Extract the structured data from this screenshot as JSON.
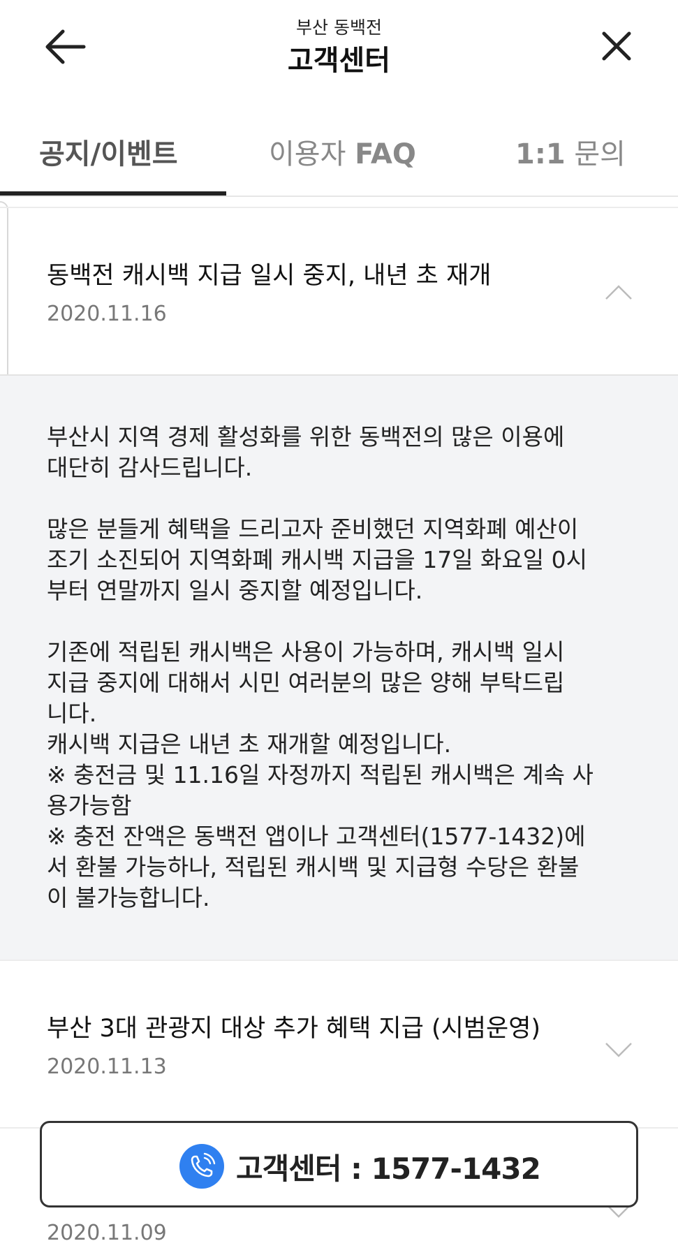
{
  "header": {
    "subtitle": "부산 동백전",
    "title": "고객센터"
  },
  "tabs": [
    {
      "label": "공지/이벤트",
      "active": true
    },
    {
      "label_prefix": "이용자 ",
      "label_bold": "FAQ",
      "active": false
    },
    {
      "label_bold": "1:1",
      "label_suffix": " 문의",
      "active": false
    }
  ],
  "notices": [
    {
      "title": "동백전 캐시백 지급 일시 중지, 내년 초 재개",
      "date": "2020.11.16",
      "expanded": true,
      "body": "부산시 지역 경제 활성화를 위한 동백전의 많은 이용에\n대단히 감사드립니다.\n\n많은 분들게 혜택을 드리고자 준비했던 지역화폐 예산이\n조기 소진되어 지역화폐 캐시백 지급을 17일 화요일 0시\n부터 연말까지 일시 중지할 예정입니다.\n\n기존에 적립된 캐시백은 사용이 가능하며, 캐시백 일시\n지급 중지에 대해서 시민 여러분의 많은 양해 부탁드립\n니다.\n캐시백 지급은 내년 초 재개할 예정입니다.\n※ 충전금 및 11.16일 자정까지 적립된 캐시백은 계속 사\n용가능함\n※ 충전 잔액은 동백전 앱이나 고객센터(1577-1432)에\n서 환불 가능하나, 적립된 캐시백 및 지급형 수당은 환불\n이 불가능합니다."
    },
    {
      "title": "부산 3대 관광지 대상 추가 혜택 지급 (시범운영)",
      "date": "2020.11.13",
      "expanded": false
    },
    {
      "title": "",
      "date": "2020.11.09",
      "expanded": false
    }
  ],
  "call_button": {
    "label": "고객센터 : 1577-1432"
  },
  "colors": {
    "accent": "#2f80f0",
    "body_bg": "#f3f4f6",
    "tab_indicator": "#222222"
  },
  "icons": {
    "back": "arrow-left-icon",
    "close": "close-icon",
    "expand": "chevron-down-icon",
    "collapse": "chevron-up-icon",
    "phone": "phone-icon"
  }
}
